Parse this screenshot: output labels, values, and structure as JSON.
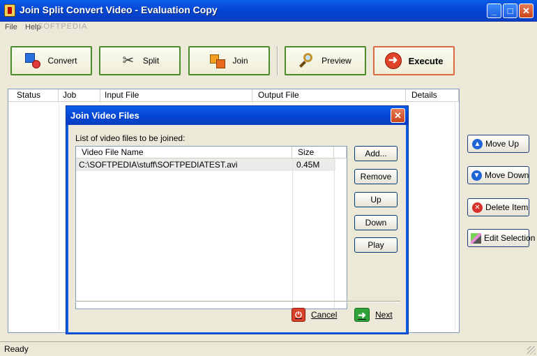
{
  "window": {
    "title": "Join Split Convert Video - Evaluation Copy"
  },
  "menu": {
    "file": "File",
    "help": "Help"
  },
  "watermark": "SOFTPEDIA",
  "toolbar": {
    "convert": "Convert",
    "split": "Split",
    "join": "Join",
    "preview": "Preview",
    "execute": "Execute"
  },
  "table": {
    "columns": [
      "Status",
      "Job",
      "Input File",
      "Output File",
      "Details"
    ]
  },
  "side_buttons": {
    "move_up": "Move Up",
    "move_down": "Move Down",
    "delete_item": "Delete Item",
    "edit_selection": "Edit Selection"
  },
  "status_bar": {
    "text": "Ready"
  },
  "dialog": {
    "title": "Join Video Files",
    "label": "List of video files to be joined:",
    "columns": [
      "Video File Name",
      "Size"
    ],
    "files": [
      {
        "name": "C:\\SOFTPEDIA\\stuff\\SOFTPEDIATEST.avi",
        "size": "0.45M"
      }
    ],
    "buttons": {
      "add": "Add...",
      "remove": "Remove",
      "up": "Up",
      "down": "Down",
      "play": "Play"
    },
    "cancel": "Cancel",
    "next": "Next"
  },
  "colors": {
    "title_blue": "#0447d6",
    "toolbar_border": "#4b8b2c",
    "execute_border": "#d86a3f"
  }
}
